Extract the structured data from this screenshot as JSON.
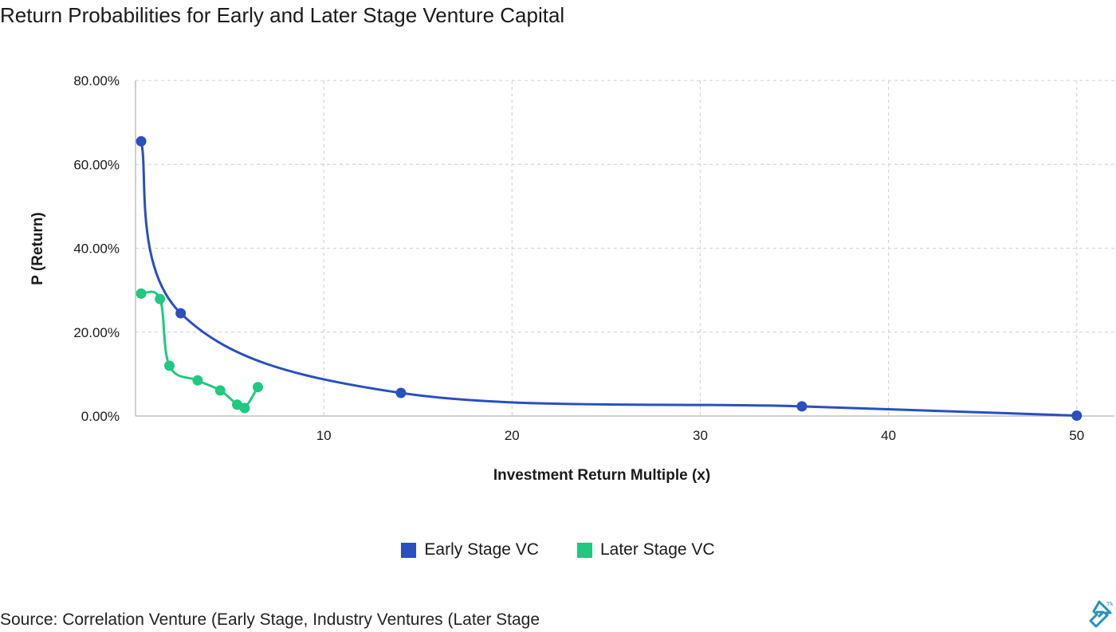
{
  "title": "Return Probabilities for Early and Later Stage Venture Capital",
  "source": "Source: Correlation Venture (Early Stage, Industry Ventures (Later Stage",
  "colors": {
    "early": "#2a4fbf",
    "later": "#1fc97f",
    "grid": "#d6d6d6",
    "axis": "#bfbfbf"
  },
  "chart_data": {
    "type": "line",
    "title": "Return Probabilities for Early and Later Stage Venture Capital",
    "xlabel": "Investment Return Multiple (x)",
    "ylabel": "P (Return)",
    "xlim": [
      0,
      52
    ],
    "ylim": [
      0,
      80
    ],
    "x_ticks": [
      10,
      20,
      30,
      40,
      50
    ],
    "x_tick_labels": [
      "10",
      "20",
      "30",
      "40",
      "50"
    ],
    "y_ticks": [
      0,
      20,
      40,
      60,
      80
    ],
    "y_tick_labels": [
      "0.00%",
      "20.00%",
      "40.00%",
      "60.00%",
      "80.00%"
    ],
    "grid": true,
    "legend_position": "bottom-center",
    "series": [
      {
        "name": "Early Stage VC",
        "x": [
          0.3,
          2.4,
          14.1,
          35.4,
          50
        ],
        "y": [
          65.5,
          24.5,
          5.5,
          2.3,
          0.1
        ]
      },
      {
        "name": "Later Stage VC",
        "x": [
          0.3,
          1.3,
          1.8,
          3.3,
          4.5,
          5.4,
          5.8,
          6.5
        ],
        "y": [
          29.2,
          27.9,
          12.0,
          8.5,
          6.1,
          2.7,
          1.9,
          6.9
        ]
      }
    ]
  }
}
